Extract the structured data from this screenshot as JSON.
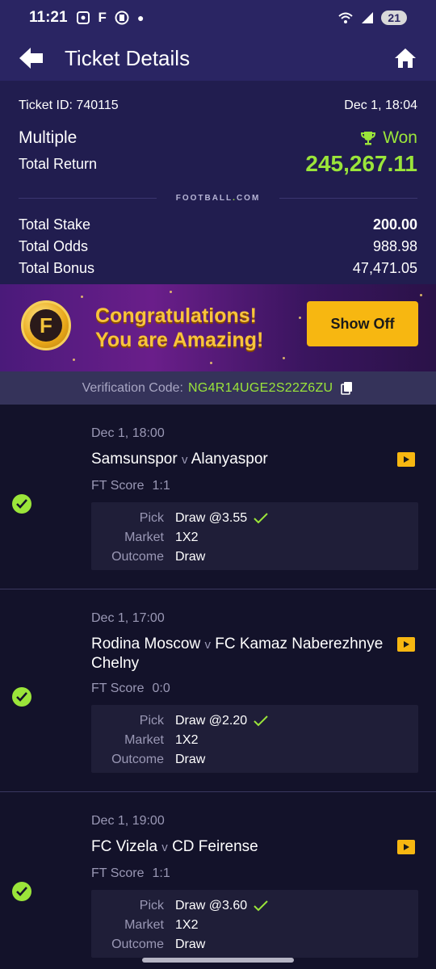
{
  "status_bar": {
    "time": "11:21",
    "battery": "21",
    "signal": "6"
  },
  "app_bar": {
    "title": "Ticket Details"
  },
  "summary": {
    "ticket_id": "Ticket ID: 740115",
    "datetime": "Dec 1, 18:04",
    "type": "Multiple",
    "status": "Won",
    "total_return_label": "Total Return",
    "total_return": "245,267.11",
    "brand": "FOOTBALL",
    "brand_dot": ".",
    "brand_tld": "COM",
    "stats": [
      {
        "label": "Total Stake",
        "value": "200.00"
      },
      {
        "label": "Total Odds",
        "value": "988.98"
      },
      {
        "label": "Total Bonus",
        "value": "47,471.05"
      }
    ]
  },
  "banner": {
    "coin_letter": "F",
    "line1": "Congratulations!",
    "line2": "You are Amazing!",
    "button": "Show Off"
  },
  "verification": {
    "label": "Verification Code:",
    "code": "NG4R14UGE2S22Z6ZU"
  },
  "matches": [
    {
      "date": "Dec 1, 18:00",
      "home": "Samsunspor",
      "vs": "v",
      "away": "Alanyaspor",
      "ft_label": "FT Score",
      "ft_score": "1:1",
      "pick_label": "Pick",
      "pick": "Draw @3.55",
      "market_label": "Market",
      "market": "1X2",
      "outcome_label": "Outcome",
      "outcome": "Draw"
    },
    {
      "date": "Dec 1, 17:00",
      "home": "Rodina Moscow",
      "vs": "v",
      "away": "FC Kamaz Naberezhnye Chelny",
      "ft_label": "FT Score",
      "ft_score": "0:0",
      "pick_label": "Pick",
      "pick": "Draw @2.20",
      "market_label": "Market",
      "market": "1X2",
      "outcome_label": "Outcome",
      "outcome": "Draw"
    },
    {
      "date": "Dec 1, 19:00",
      "home": "FC Vizela",
      "vs": "v",
      "away": "CD Feirense",
      "ft_label": "FT Score",
      "ft_score": "1:1",
      "pick_label": "Pick",
      "pick": "Draw @3.60",
      "market_label": "Market",
      "market": "1X2",
      "outcome_label": "Outcome",
      "outcome": "Draw"
    }
  ]
}
